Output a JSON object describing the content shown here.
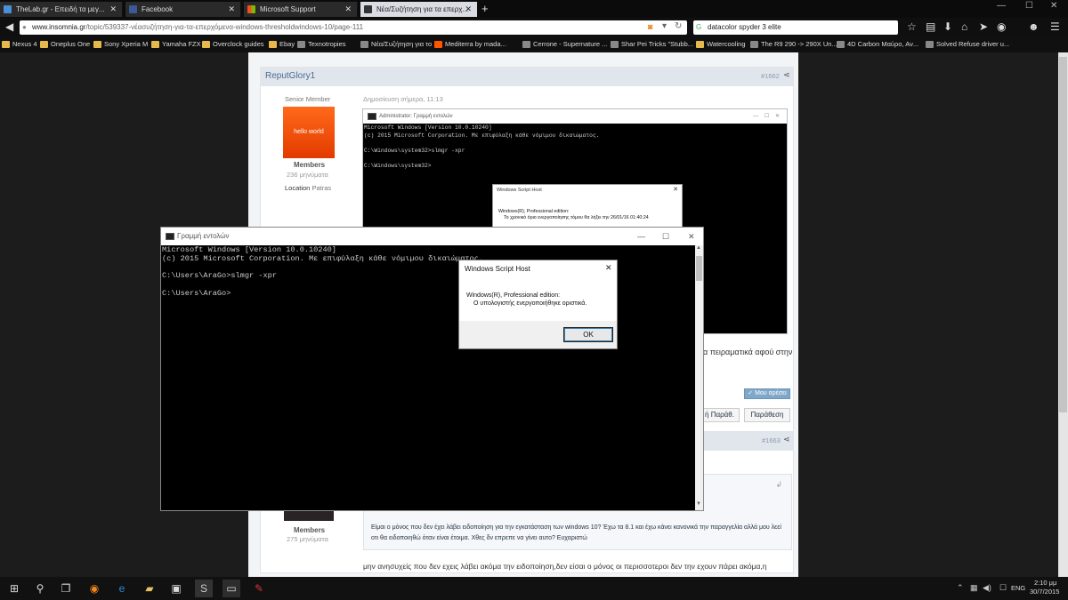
{
  "browser": {
    "tabs": [
      {
        "label": "TheLab.gr - Επειδή τα μεγ..."
      },
      {
        "label": "Facebook"
      },
      {
        "label": "Microsoft Support"
      },
      {
        "label": "Νέα/Συζήτηση για τα επερχ..."
      }
    ],
    "url_domain": "www.insomnia.gr",
    "url_path": "/topic/539337-νέασυζήτηση-για-τα-επερχόμενα-windows-thresholdwindows-10/page-111",
    "search_value": "datacolor spyder 3 elite",
    "bookmarks": [
      "Nexus 4",
      "Oneplus One",
      "Sony Xperia M",
      "Yamaha FZX",
      "Overclock guides",
      "Ebay",
      "Texnotropies",
      "Νέα/Συζήτηση για το ...",
      "Mediterra by mada...",
      "Cerrone - Supernature ...",
      "Shar Pei Tricks \"Stubb...",
      "Watercooling",
      "The R9 290 -> 290X Un...",
      "4D Carbon Μαύρο, Αν...",
      "Solved Refuse driver u..."
    ]
  },
  "post1": {
    "author": "ReputGlory1",
    "number": "#1662",
    "rank": "Senior Member",
    "date": "Δημοσίευση σήμερα, 11:13",
    "avatar_text": "hello world",
    "group": "Members",
    "posts": "236 μηνύματα",
    "location_label": "Location",
    "location_value": "Patras",
    "trailing_text": "α πειραματικά αφού στην",
    "liked": "Μου αρέσει",
    "quote_btn": "ή Παράθ.",
    "reply_btn": "Παράθεση"
  },
  "post2": {
    "number": "#1663",
    "group": "Members",
    "posts": "275 μηνύματα",
    "quote_text": "Είμαι ο μόνος που δεν έχει λάβει ειδοποίηση για την εγκατάσταση των windows 10? Έχω τα 8.1 και έχω κάνει κανονικά την παραγγελία αλλά μου λεεί οτι θα ειδοποιηθώ όταν είναι έτοιμα. Χθες δν επρεπε να γίνει αυτο? Ευχαριστώ",
    "reply_text": "μην ανησυχείς που δεν εχεις λάβει ακόμα την ειδοποίηση,δεν είσαι ο μόνος οι περισσοτεροι δεν την εχουν πάρει ακόμα,η"
  },
  "embedded_cmd": {
    "title": "Administrator: Γραμμή εντολών",
    "lines": "Microsoft Windows [Version 10.0.10240]\n(c) 2015 Microsoft Corporation. Με επιφύλαξη κάθε νόμιμου δικαιώματος.\n\nC:\\Windows\\system32>slmgr -xpr\n\nC:\\Windows\\system32>",
    "dialog_title": "Windows Script Host",
    "dialog_line1": "Windows(R), Professional edition:",
    "dialog_line2": "Το χρονικό όριο ενεργοποίησης τόμου θα λήξει την 26/01/16 01:40:24"
  },
  "cmd": {
    "title": "Γραμμή εντολών",
    "lines": "Microsoft Windows [Version 10.0.10240]\n(c) 2015 Microsoft Corporation. Με επιφύλαξη κάθε νόμιμου δικαιώματος.\n\nC:\\Users\\AraGo>slmgr -xpr\n\nC:\\Users\\AraGo>"
  },
  "dialog": {
    "title": "Windows Script Host",
    "line1": "Windows(R), Professional edition:",
    "line2": "Ο υπολογιστής ενεργοποιήθηκε οριστικά.",
    "ok": "OK"
  },
  "taskbar": {
    "lang": "ENG",
    "time": "2:10 μμ",
    "date": "30/7/2015"
  }
}
